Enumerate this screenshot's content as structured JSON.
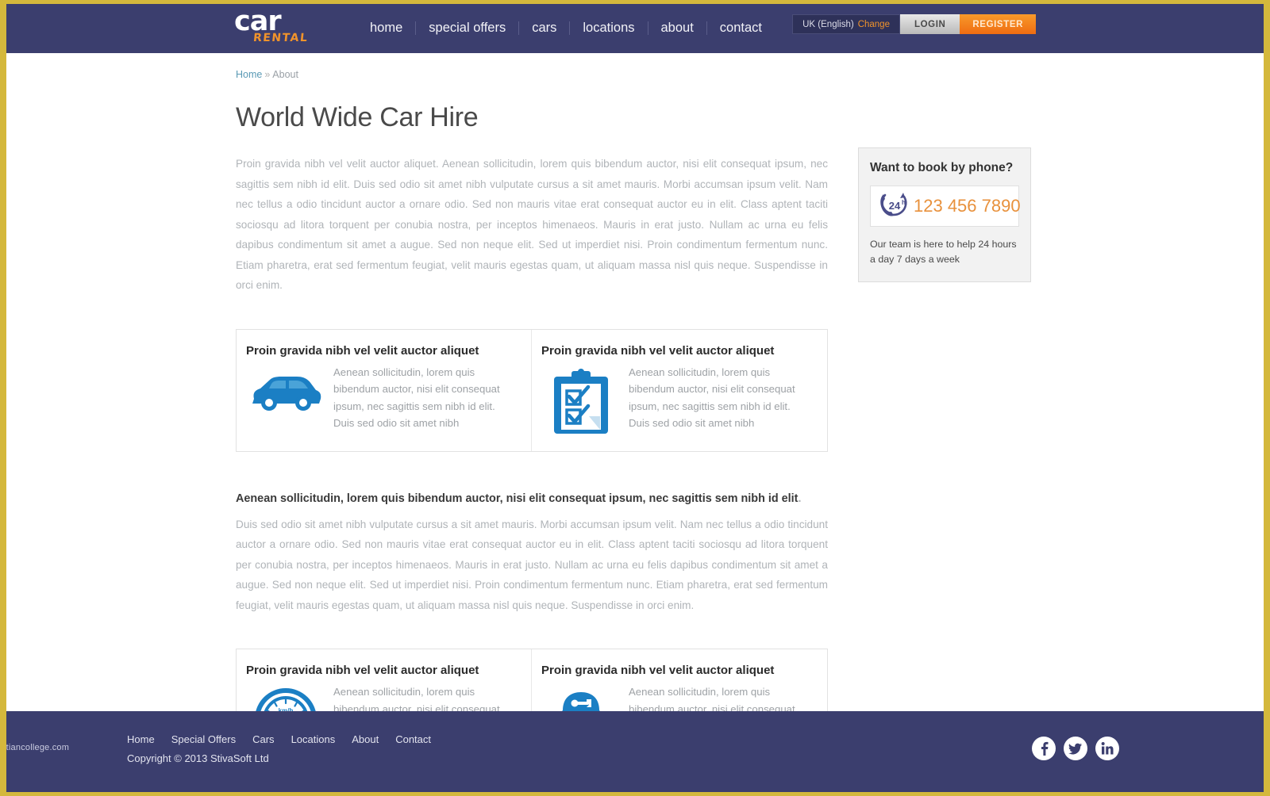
{
  "header": {
    "logo": {
      "primary": "car",
      "secondary": "RENTAL"
    },
    "nav": [
      {
        "label": "home"
      },
      {
        "label": "special offers"
      },
      {
        "label": "cars"
      },
      {
        "label": "locations"
      },
      {
        "label": "about"
      },
      {
        "label": "contact"
      }
    ],
    "language": {
      "value": "UK (English)",
      "change_label": "Change"
    },
    "login_label": "LOGIN",
    "register_label": "REGISTER"
  },
  "breadcrumb": {
    "home": "Home",
    "separator": "»",
    "current": "About"
  },
  "page_title": "World Wide Car Hire",
  "intro_paragraph": "Proin gravida nibh vel velit auctor aliquet. Aenean sollicitudin, lorem quis bibendum auctor, nisi elit consequat ipsum, nec sagittis sem nibh id elit. Duis sed odio sit amet nibh vulputate cursus a sit amet mauris. Morbi accumsan ipsum velit. Nam nec tellus a odio tincidunt auctor a ornare odio. Sed non  mauris vitae erat consequat auctor eu in elit. Class aptent taciti sociosqu ad litora torquent per conubia nostra, per inceptos himenaeos. Mauris in erat justo. Nullam ac urna eu felis dapibus condimentum sit amet a augue. Sed non neque elit. Sed ut imperdiet nisi. Proin condimentum fermentum nunc. Etiam pharetra, erat sed fermentum feugiat, velit mauris egestas quam, ut aliquam massa nisl quis neque. Suspendisse in orci enim.",
  "sidebar": {
    "phone_box": {
      "title": "Want to book by phone?",
      "icon": "phone-24h-icon",
      "number": "123 456 7890",
      "note": "Our team is here to help 24 hours a day 7 days a week"
    }
  },
  "feature_rows": [
    {
      "cells": [
        {
          "title": "Proin gravida nibh vel velit auctor aliquet",
          "icon": "car-icon",
          "text": "Aenean sollicitudin, lorem quis bibendum auctor, nisi elit consequat ipsum, nec sagittis sem nibh id elit. Duis sed odio sit amet nibh"
        },
        {
          "title": "Proin gravida nibh vel velit auctor aliquet",
          "icon": "clipboard-checklist-icon",
          "text": "Aenean sollicitudin, lorem quis bibendum auctor, nisi elit consequat ipsum, nec sagittis sem nibh id elit. Duis sed odio sit amet nibh"
        }
      ]
    },
    {
      "cells": [
        {
          "title": "Proin gravida nibh vel velit auctor aliquet",
          "icon": "speedometer-icon",
          "text": "Aenean sollicitudin, lorem quis bibendum auctor, nisi elit consequat ipsum, nec sagittis sem nibh id elit. Duis sed odio sit amet nibh"
        },
        {
          "title": "Proin gravida nibh vel velit auctor aliquet",
          "icon": "mechanic-icon",
          "text": "Aenean sollicitudin, lorem quis bibendum auctor, nisi elit consequat ipsum, nec sagittis sem nibh id elit. Duis sed odio sit amet nibh"
        }
      ]
    }
  ],
  "section": {
    "lead": "Aenean sollicitudin, lorem quis bibendum auctor, nisi elit consequat ipsum, nec sagittis sem nibh id elit",
    "lead_trailing": ".",
    "body": "Duis sed odio sit amet nibh vulputate cursus a sit amet mauris. Morbi accumsan ipsum velit. Nam nec tellus a odio tincidunt auctor a ornare odio. Sed non  mauris vitae erat consequat auctor eu in elit. Class aptent taciti sociosqu ad litora torquent per conubia nostra, per inceptos himenaeos. Mauris in erat justo. Nullam ac urna eu felis dapibus condimentum sit amet a augue. Sed non neque elit. Sed ut imperdiet nisi. Proin condimentum fermentum nunc. Etiam pharetra, erat sed fermentum feugiat, velit mauris egestas quam, ut aliquam massa nisl quis neque. Suspendisse in orci enim."
  },
  "footer": {
    "url": "www.heritagechristiancollege.com",
    "nav": [
      {
        "label": "Home"
      },
      {
        "label": "Special Offers"
      },
      {
        "label": "Cars"
      },
      {
        "label": "Locations"
      },
      {
        "label": "About"
      },
      {
        "label": "Contact"
      }
    ],
    "copyright": "Copyright © 2013 StivaSoft Ltd",
    "social": [
      {
        "name": "facebook-icon"
      },
      {
        "name": "twitter-icon"
      },
      {
        "name": "linkedin-icon"
      }
    ]
  },
  "colors": {
    "header_bg": "#3b3e6e",
    "page_border": "#d4b83c",
    "accent_orange": "#ef6c12",
    "icon_blue": "#1b7fc4",
    "link_blue": "#5a9ab5"
  }
}
